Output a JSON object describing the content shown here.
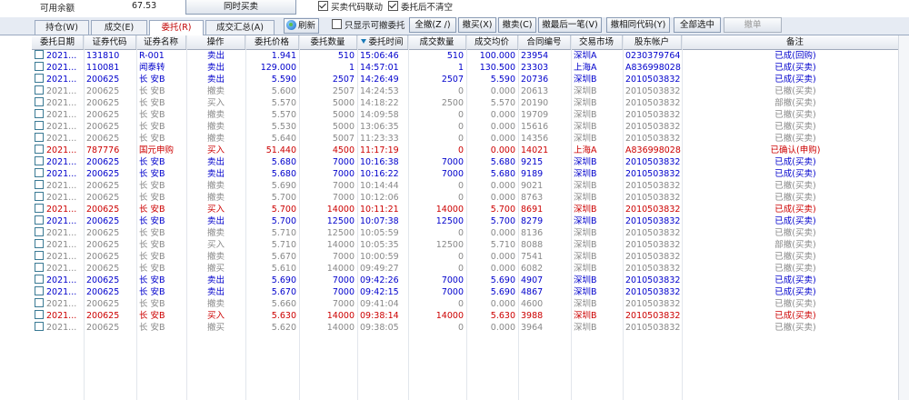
{
  "toolbar": {
    "avail_label": "可用余额",
    "avail_value": "67.53",
    "simultaneous_btn": "同时买卖",
    "chk_code_link": "买卖代码联动",
    "chk_code_link_on": true,
    "chk_no_clear": "委托后不清空",
    "chk_no_clear_on": true
  },
  "tabs": [
    "持仓(W)",
    "成交(E)",
    "委托(R)",
    "成交汇总(A)"
  ],
  "actions": {
    "refresh": "刷新",
    "only_cancelable": "只显示可撤委托",
    "cancel_all": "全撤(Z /)",
    "cancel_buy": "撤买(X)",
    "cancel_sell": "撤卖(C)",
    "cancel_last": "撤最后一笔(V)",
    "cancel_same_code": "撤相同代码(Y)",
    "select_all": "全部选中",
    "cancel_order": "撤单"
  },
  "columns": [
    "委托日期",
    "证券代码",
    "证券名称",
    "操作",
    "委托价格",
    "委托数量",
    "委托时间",
    "成交数量",
    "成交均价",
    "合同编号",
    "交易市场",
    "股东帐户",
    "备注"
  ],
  "colors": {
    "blue": "#0000cc",
    "red": "#cc0000",
    "gray": "#888888"
  },
  "rows": [
    {
      "color": "blue",
      "c": [
        "2021...",
        "131810",
        "R-001",
        "卖出",
        "1.941",
        "510",
        "15:06:46",
        "510",
        "100.000",
        "23954",
        "深圳A",
        "0230379764",
        "已成(回购)"
      ]
    },
    {
      "color": "blue",
      "c": [
        "2021...",
        "110081",
        "闻泰转",
        "卖出",
        "129.000",
        "1",
        "14:57:01",
        "1",
        "130.500",
        "23303",
        "上海A",
        "A836998028",
        "已成(买卖)"
      ]
    },
    {
      "color": "blue",
      "c": [
        "2021...",
        "200625",
        "长 安B",
        "卖出",
        "5.590",
        "2507",
        "14:26:49",
        "2507",
        "5.590",
        "20736",
        "深圳B",
        "2010503832",
        "已成(买卖)"
      ]
    },
    {
      "color": "gray",
      "c": [
        "2021...",
        "200625",
        "长 安B",
        "撤卖",
        "5.600",
        "2507",
        "14:24:53",
        "0",
        "0.000",
        "20613",
        "深圳B",
        "2010503832",
        "已撤(买卖)"
      ]
    },
    {
      "color": "gray",
      "c": [
        "2021...",
        "200625",
        "长 安B",
        "买入",
        "5.570",
        "5000",
        "14:18:22",
        "2500",
        "5.570",
        "20190",
        "深圳B",
        "2010503832",
        "部撤(买卖)"
      ]
    },
    {
      "color": "gray",
      "c": [
        "2021...",
        "200625",
        "长 安B",
        "撤卖",
        "5.570",
        "5000",
        "14:09:58",
        "0",
        "0.000",
        "19709",
        "深圳B",
        "2010503832",
        "已撤(买卖)"
      ]
    },
    {
      "color": "gray",
      "c": [
        "2021...",
        "200625",
        "长 安B",
        "撤卖",
        "5.530",
        "5000",
        "13:06:35",
        "0",
        "0.000",
        "15616",
        "深圳B",
        "2010503832",
        "已撤(买卖)"
      ]
    },
    {
      "color": "gray",
      "c": [
        "2021...",
        "200625",
        "长 安B",
        "撤卖",
        "5.640",
        "5007",
        "11:23:33",
        "0",
        "0.000",
        "14356",
        "深圳B",
        "2010503832",
        "已撤(买卖)"
      ]
    },
    {
      "color": "red",
      "c": [
        "2021...",
        "787776",
        "国元申购",
        "买入",
        "51.440",
        "4500",
        "11:17:19",
        "0",
        "0.000",
        "14021",
        "上海A",
        "A836998028",
        "已确认(申购)"
      ]
    },
    {
      "color": "blue",
      "c": [
        "2021...",
        "200625",
        "长 安B",
        "卖出",
        "5.680",
        "7000",
        "10:16:38",
        "7000",
        "5.680",
        "9215",
        "深圳B",
        "2010503832",
        "已成(买卖)"
      ]
    },
    {
      "color": "blue",
      "c": [
        "2021...",
        "200625",
        "长 安B",
        "卖出",
        "5.680",
        "7000",
        "10:16:22",
        "7000",
        "5.680",
        "9189",
        "深圳B",
        "2010503832",
        "已成(买卖)"
      ]
    },
    {
      "color": "gray",
      "c": [
        "2021...",
        "200625",
        "长 安B",
        "撤卖",
        "5.690",
        "7000",
        "10:14:44",
        "0",
        "0.000",
        "9021",
        "深圳B",
        "2010503832",
        "已撤(买卖)"
      ]
    },
    {
      "color": "gray",
      "c": [
        "2021...",
        "200625",
        "长 安B",
        "撤卖",
        "5.700",
        "7000",
        "10:12:06",
        "0",
        "0.000",
        "8763",
        "深圳B",
        "2010503832",
        "已撤(买卖)"
      ]
    },
    {
      "color": "red",
      "c": [
        "2021...",
        "200625",
        "长 安B",
        "买入",
        "5.700",
        "14000",
        "10:11:21",
        "14000",
        "5.700",
        "8691",
        "深圳B",
        "2010503832",
        "已成(买卖)"
      ]
    },
    {
      "color": "blue",
      "c": [
        "2021...",
        "200625",
        "长 安B",
        "卖出",
        "5.700",
        "12500",
        "10:07:38",
        "12500",
        "5.700",
        "8279",
        "深圳B",
        "2010503832",
        "已成(买卖)"
      ]
    },
    {
      "color": "gray",
      "c": [
        "2021...",
        "200625",
        "长 安B",
        "撤卖",
        "5.710",
        "12500",
        "10:05:59",
        "0",
        "0.000",
        "8136",
        "深圳B",
        "2010503832",
        "已撤(买卖)"
      ]
    },
    {
      "color": "gray",
      "c": [
        "2021...",
        "200625",
        "长 安B",
        "买入",
        "5.710",
        "14000",
        "10:05:35",
        "12500",
        "5.710",
        "8088",
        "深圳B",
        "2010503832",
        "部撤(买卖)"
      ]
    },
    {
      "color": "gray",
      "c": [
        "2021...",
        "200625",
        "长 安B",
        "撤卖",
        "5.670",
        "7000",
        "10:00:59",
        "0",
        "0.000",
        "7541",
        "深圳B",
        "2010503832",
        "已撤(买卖)"
      ]
    },
    {
      "color": "gray",
      "c": [
        "2021...",
        "200625",
        "长 安B",
        "撤买",
        "5.610",
        "14000",
        "09:49:27",
        "0",
        "0.000",
        "6082",
        "深圳B",
        "2010503832",
        "已撤(买卖)"
      ]
    },
    {
      "color": "blue",
      "c": [
        "2021...",
        "200625",
        "长 安B",
        "卖出",
        "5.690",
        "7000",
        "09:42:26",
        "7000",
        "5.690",
        "4907",
        "深圳B",
        "2010503832",
        "已成(买卖)"
      ]
    },
    {
      "color": "blue",
      "c": [
        "2021...",
        "200625",
        "长 安B",
        "卖出",
        "5.670",
        "7000",
        "09:42:15",
        "7000",
        "5.690",
        "4867",
        "深圳B",
        "2010503832",
        "已成(买卖)"
      ]
    },
    {
      "color": "gray",
      "c": [
        "2021...",
        "200625",
        "长 安B",
        "撤卖",
        "5.660",
        "7000",
        "09:41:04",
        "0",
        "0.000",
        "4600",
        "深圳B",
        "2010503832",
        "已撤(买卖)"
      ]
    },
    {
      "color": "red",
      "c": [
        "2021...",
        "200625",
        "长 安B",
        "买入",
        "5.630",
        "14000",
        "09:38:14",
        "14000",
        "5.630",
        "3988",
        "深圳B",
        "2010503832",
        "已成(买卖)"
      ]
    },
    {
      "color": "gray",
      "c": [
        "2021...",
        "200625",
        "长 安B",
        "撤买",
        "5.620",
        "14000",
        "09:38:05",
        "0",
        "0.000",
        "3964",
        "深圳B",
        "2010503832",
        "已撤(买卖)"
      ]
    }
  ]
}
